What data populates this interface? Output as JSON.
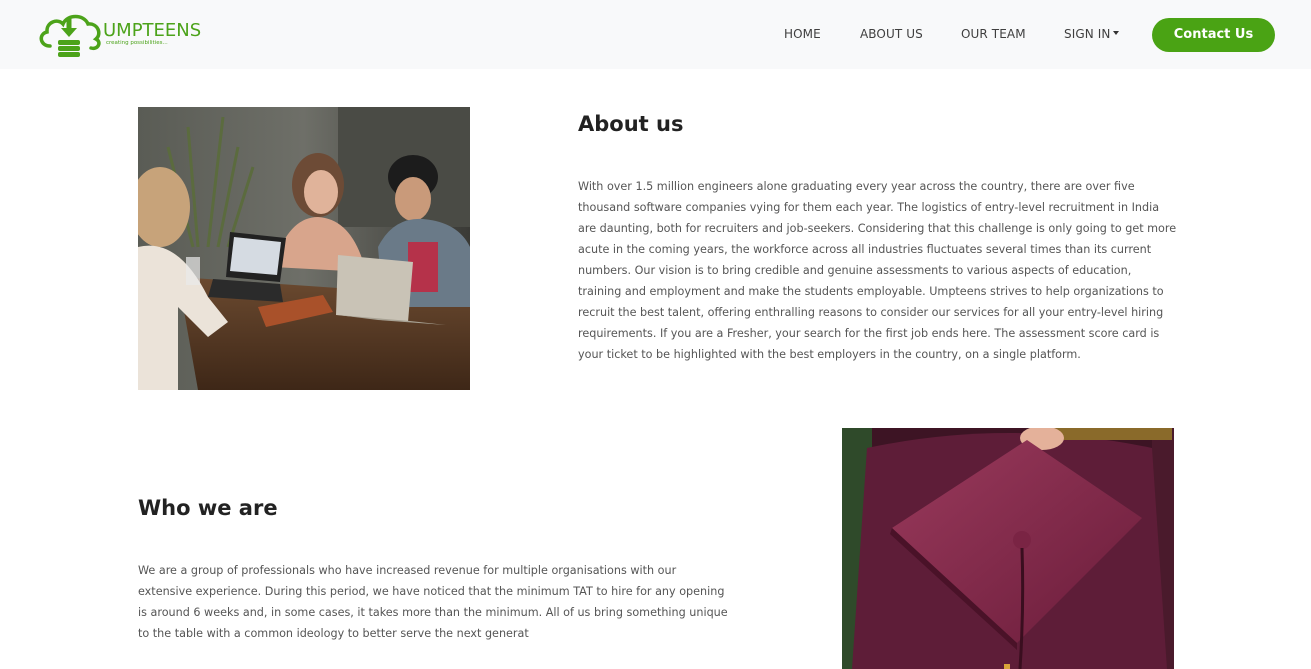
{
  "brand": {
    "name": "UMPTEENS",
    "tagline": "creating possibilities...",
    "color": "#4ca31a"
  },
  "nav": {
    "items": [
      {
        "label": "HOME"
      },
      {
        "label": "ABOUT US"
      },
      {
        "label": "OUR TEAM"
      },
      {
        "label": "SIGN IN"
      }
    ],
    "contact_label": "Contact Us",
    "accent": "#4aa314"
  },
  "about": {
    "heading": "About us",
    "body": "With over 1.5 million engineers alone graduating every year across the country, there are over five thousand software companies vying for them each year. The logistics of entry-level recruitment in India are daunting, both for recruiters and job-seekers. Considering that this challenge is only going to get more acute in the coming years, the workforce across all industries fluctuates several times than its current numbers. Our vision is to bring credible and genuine assessments to various aspects of education, training and employment and make the students employable. Umpteens strives to help organizations to recruit the best talent, offering enthralling reasons to consider our services for all your entry-level hiring requirements. If you are a Fresher, your search for the first job ends here. The assessment score card is your ticket to be highlighted with the best employers in the country, on a single platform.",
    "image_icon": "photo-team-at-laptops"
  },
  "who": {
    "heading": "Who we are",
    "body": "We are a group of professionals who have increased revenue for multiple organisations with our extensive experience. During this period, we have noticed that the minimum TAT to hire for any opening is around 6 weeks and, in some cases, it takes more than the minimum. All of us bring something unique to the table with a common ideology to better serve the next generat",
    "image_icon": "photo-graduation-cap"
  }
}
